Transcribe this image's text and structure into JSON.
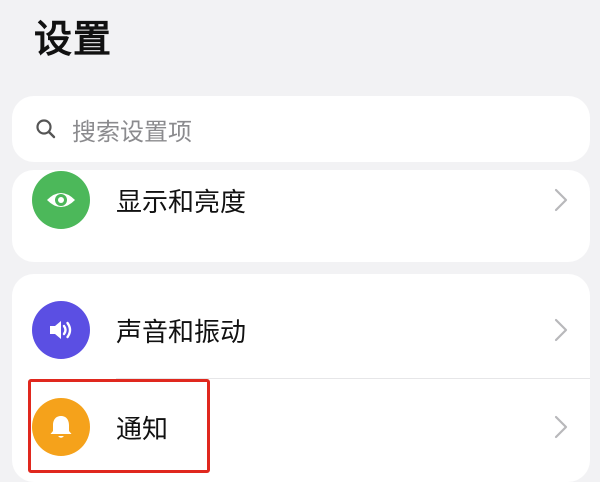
{
  "header": {
    "title": "设置"
  },
  "search": {
    "placeholder": "搜索设置项",
    "icon": "search-icon"
  },
  "settings": {
    "display": {
      "label": "显示和亮度",
      "icon": "eye-icon",
      "icon_color": "#4cb85a"
    },
    "sound": {
      "label": "声音和振动",
      "icon": "speaker-icon",
      "icon_color": "#5b4fe3"
    },
    "notification": {
      "label": "通知",
      "icon": "bell-icon",
      "icon_color": "#f5a21b"
    }
  },
  "colors": {
    "background": "#f2f2f4",
    "card": "#ffffff",
    "highlight": "#e0281e"
  }
}
